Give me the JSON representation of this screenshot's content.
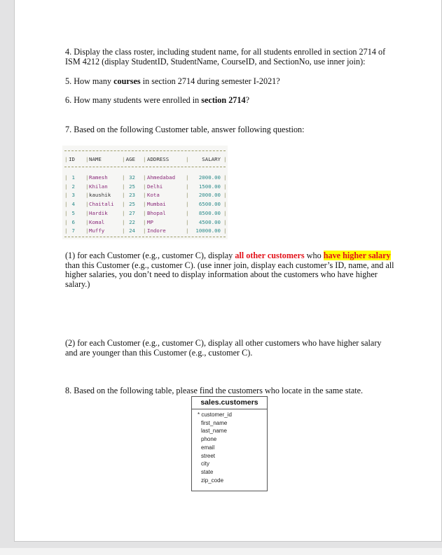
{
  "document": {
    "q4": {
      "line1": "4. Display the class roster, including student name, for all students enrolled in section 2714 of",
      "line2": "ISM 4212 (display StudentID, StudentName, CourseID, and SectionNo, use inner join):"
    },
    "q5": {
      "pre": "5. How many ",
      "bold": "courses",
      "post": " in section 2714 during semester I-2021?"
    },
    "q6": {
      "pre": "6. How many students were enrolled in ",
      "bold": "section 2714",
      "post": "?"
    },
    "q7": {
      "text": "7. Based on the following Customer table, answer following question:"
    },
    "customer_table": {
      "headers": [
        "ID",
        "NAME",
        "AGE",
        "ADDRESS",
        "SALARY"
      ],
      "rows": [
        [
          "1",
          "Ramesh",
          "32",
          "Ahmedabad",
          "2000.00"
        ],
        [
          "2",
          "Khilan",
          "25",
          "Delhi",
          "1500.00"
        ],
        [
          "3",
          "kaushik",
          "23",
          "Kota",
          "2000.00"
        ],
        [
          "4",
          "Chaitali",
          "25",
          "Mumbai",
          "6500.00"
        ],
        [
          "5",
          "Hardik",
          "27",
          "Bhopal",
          "8500.00"
        ],
        [
          "6",
          "Komal",
          "22",
          "MP",
          "4500.00"
        ],
        [
          "7",
          "Muffy",
          "24",
          "Indore",
          "10000.00"
        ]
      ]
    },
    "q7_1": {
      "pre": "(1) for each Customer (e.g., customer C), display ",
      "red": "all other customers",
      "mid": " who ",
      "highlight": "have higher salary",
      "post": " than this Customer (e.g., customer C). (use inner join, display each customer’s ID, name, and all higher salaries, you don’t need to display information about the customers who have higher salary.)"
    },
    "q7_2": {
      "text": "(2) for each Customer (e.g., customer C), display all other customers who have higher salary and are younger than this Customer (e.g., customer C)."
    },
    "q8": {
      "text": "8. Based on the following table, please find the customers who locate in the same state."
    },
    "er_table": {
      "title": "sales.customers",
      "pk_marker": "*",
      "fields": [
        "customer_id",
        "first_name",
        "last_name",
        "phone",
        "email",
        "street",
        "city",
        "state",
        "zip_code"
      ]
    }
  },
  "colors": {
    "emphasis_red": "#e3131b",
    "highlight_yellow": "#ffff00",
    "table_string": "#8a2a7a",
    "table_number": "#2b8a8a"
  }
}
